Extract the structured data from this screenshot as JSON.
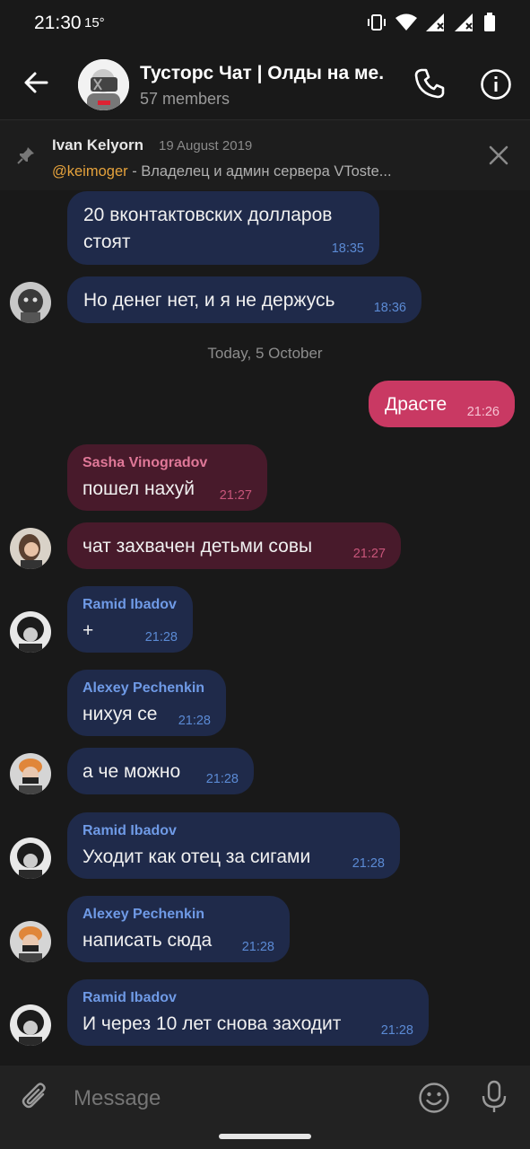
{
  "status_bar": {
    "time": "21:30",
    "temperature": "15°"
  },
  "header": {
    "title": "Тусторс Чат | Олды на ме.",
    "subtitle": "57 members"
  },
  "pinned": {
    "author": "Ivan Kelyorn",
    "date": "19 August 2019",
    "mention": "@keimoger",
    "text": " - Владелец и админ сервера VToste..."
  },
  "date_separator": "Today, 5 October",
  "messages": [
    {
      "text1": "20 вконтактовских долларов",
      "text2": "стоят",
      "time": "18:35"
    },
    {
      "text": "Но денег нет, и я не держусь",
      "time": "18:36"
    },
    {
      "text": "Драсте",
      "time": "21:26"
    },
    {
      "sender": "Sasha Vinogradov",
      "text": "пошел нахуй",
      "time": "21:27"
    },
    {
      "text": "чат захвачен детьми совы",
      "time": "21:27"
    },
    {
      "sender": "Ramid Ibadov",
      "text": "+",
      "time": "21:28"
    },
    {
      "sender": "Alexey Pechenkin",
      "text": "нихуя се",
      "time": "21:28"
    },
    {
      "text": "а че можно",
      "time": "21:28"
    },
    {
      "sender": "Ramid Ibadov",
      "text": "Уходит как отец за сигами",
      "time": "21:28"
    },
    {
      "sender": "Alexey Pechenkin",
      "text": "написать сюда",
      "time": "21:28"
    },
    {
      "sender": "Ramid Ibadov",
      "text": "И через 10 лет снова заходит",
      "time": "21:28"
    }
  ],
  "input": {
    "placeholder": "Message"
  },
  "colors": {
    "background": "#191919",
    "bubble_incoming": "#1f2a4a",
    "bubble_sasha": "#481a2b",
    "bubble_outgoing": "#c93963",
    "mention": "#e5a23c",
    "sender_blue": "#6f9ae6"
  },
  "icons": [
    "back-arrow-icon",
    "phone-icon",
    "info-icon",
    "pin-icon",
    "close-icon",
    "paperclip-icon",
    "emoji-icon",
    "microphone-icon"
  ]
}
